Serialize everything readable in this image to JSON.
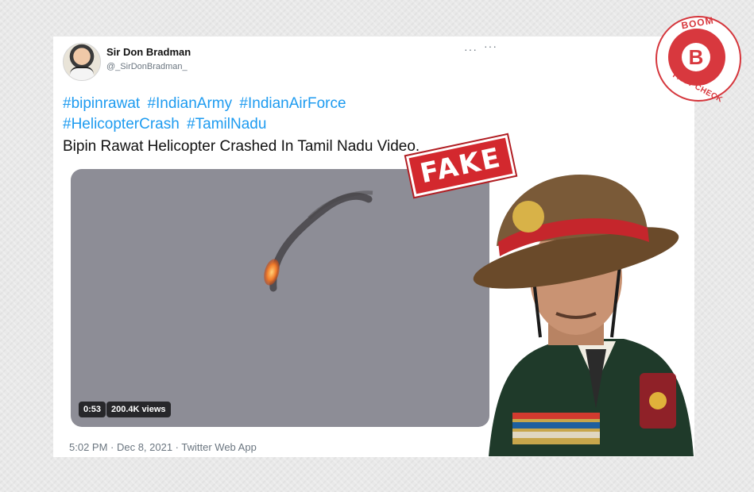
{
  "tweet": {
    "author_name": "Sir Don Bradman",
    "author_handle": "@_SirDonBradman_",
    "more_icon": "more-icon",
    "hashtags": [
      "#bipinrawat",
      "#IndianArmy",
      "#IndianAirForce",
      "#HelicopterCrash",
      "#TamilNadu"
    ],
    "text": "Bipin Rawat Helicopter Crashed In Tamil Nadu Video.",
    "video": {
      "duration": "0:53",
      "views": "200.4K views"
    },
    "timestamp": "5:02 PM · Dec 8, 2021 · Twitter Web App"
  },
  "stamp": {
    "label": "FAKE"
  },
  "logo": {
    "top_text": "BOOM",
    "letter": "B",
    "bottom_text": "FACT CHECK"
  },
  "colors": {
    "link": "#1d9bf0",
    "stamp": "#d3282e",
    "logo": "#d8383e",
    "card": "#ffffff"
  }
}
